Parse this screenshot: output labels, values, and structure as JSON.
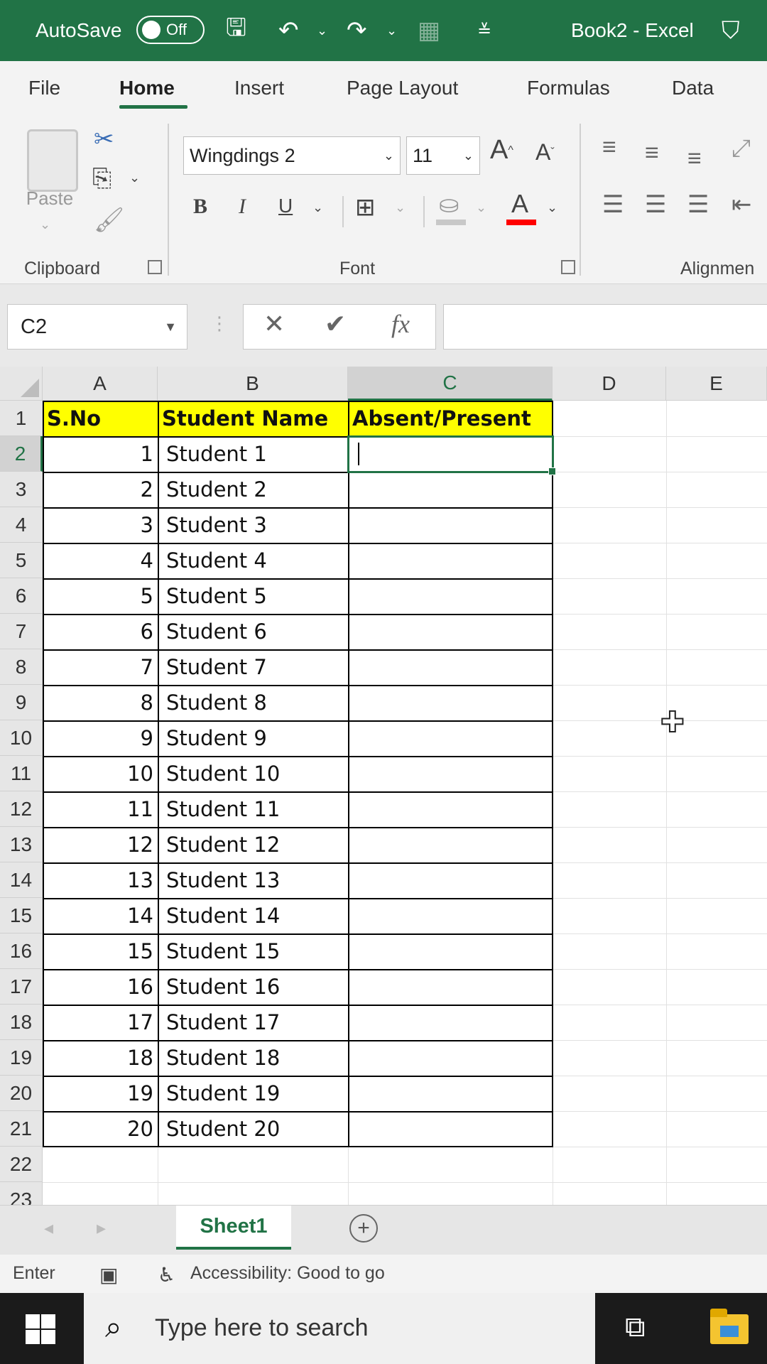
{
  "titlebar": {
    "autosave_label": "AutoSave",
    "autosave_state": "Off",
    "title": "Book2  -  Excel",
    "accent": "#217346"
  },
  "menu": {
    "tabs": [
      "File",
      "Home",
      "Insert",
      "Page Layout",
      "Formulas",
      "Data"
    ],
    "active": "Home"
  },
  "ribbon": {
    "paste_label": "Paste",
    "clipboard_label": "Clipboard",
    "font_label": "Font",
    "alignment_label": "Alignmen",
    "font_name": "Wingdings 2",
    "font_size": "11",
    "bold": "B",
    "italic": "I",
    "underline": "U",
    "font_color_letter": "A",
    "grow_font": "A",
    "shrink_font": "A",
    "font_color": "#ff0000"
  },
  "formula_bar": {
    "name_box": "C2",
    "cancel": "✕",
    "enter": "✔",
    "fx": "fx",
    "value": ""
  },
  "grid": {
    "columns": [
      "A",
      "B",
      "C",
      "D",
      "E"
    ],
    "selected_column": "C",
    "rows": [
      "1",
      "2",
      "3",
      "4",
      "5",
      "6",
      "7",
      "8",
      "9",
      "10",
      "11",
      "12",
      "13",
      "14",
      "15",
      "16",
      "17",
      "18",
      "19",
      "20",
      "21",
      "22",
      "23"
    ],
    "selected_row": "2",
    "headers": [
      "S.No",
      "Student Name",
      "Absent/Present"
    ],
    "header_fill": "#ffff00",
    "data": [
      {
        "sno": "1",
        "name": "Student 1"
      },
      {
        "sno": "2",
        "name": "Student 2"
      },
      {
        "sno": "3",
        "name": "Student 3"
      },
      {
        "sno": "4",
        "name": "Student 4"
      },
      {
        "sno": "5",
        "name": "Student 5"
      },
      {
        "sno": "6",
        "name": "Student 6"
      },
      {
        "sno": "7",
        "name": "Student 7"
      },
      {
        "sno": "8",
        "name": "Student 8"
      },
      {
        "sno": "9",
        "name": "Student 9"
      },
      {
        "sno": "10",
        "name": "Student 10"
      },
      {
        "sno": "11",
        "name": "Student 11"
      },
      {
        "sno": "12",
        "name": "Student 12"
      },
      {
        "sno": "13",
        "name": "Student 13"
      },
      {
        "sno": "14",
        "name": "Student 14"
      },
      {
        "sno": "15",
        "name": "Student 15"
      },
      {
        "sno": "16",
        "name": "Student 16"
      },
      {
        "sno": "17",
        "name": "Student 17"
      },
      {
        "sno": "18",
        "name": "Student 18"
      },
      {
        "sno": "19",
        "name": "Student 19"
      },
      {
        "sno": "20",
        "name": "Student 20"
      }
    ],
    "active_cell": "C2"
  },
  "sheets": {
    "tabs": [
      "Sheet1"
    ],
    "active": "Sheet1"
  },
  "status": {
    "mode": "Enter",
    "accessibility": "Accessibility: Good to go"
  },
  "taskbar": {
    "search_placeholder": "Type here to search"
  }
}
